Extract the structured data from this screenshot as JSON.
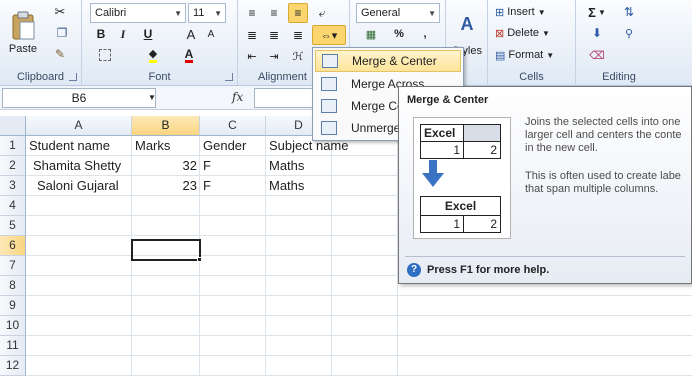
{
  "ribbon": {
    "clipboard": {
      "paste_label": "Paste",
      "group_label": "Clipboard"
    },
    "font": {
      "name": "Calibri",
      "size": "11",
      "bold": "B",
      "italic": "I",
      "underline": "U",
      "grow": "A",
      "shrink": "A",
      "font_color_letter": "A",
      "group_label": "Font"
    },
    "alignment": {
      "group_label": "Alignment"
    },
    "number": {
      "format": "General",
      "percent": "%",
      "comma": ","
    },
    "styles": {
      "label": "Styles"
    },
    "cells": {
      "insert": "Insert",
      "delete": "Delete",
      "format": "Format",
      "group_label": "Cells"
    },
    "editing": {
      "sigma": "Σ",
      "group_label": "Editing"
    }
  },
  "formula_bar": {
    "name_box": "B6",
    "fx_label": "fx"
  },
  "grid": {
    "columns": [
      "A",
      "B",
      "C",
      "D"
    ],
    "rows": [
      "1",
      "2",
      "3",
      "4",
      "5",
      "6",
      "7",
      "8",
      "9",
      "10",
      "11",
      "12"
    ],
    "cells": {
      "a1": "Student name",
      "b1": "Marks",
      "c1": "Gender",
      "d1": "Subject name",
      "a2": "Shamita Shetty",
      "b2": "32",
      "c2": "F",
      "d2": "Maths",
      "a3": "Saloni Gujaral",
      "b3": "23",
      "c3": "F",
      "d3": "Maths"
    }
  },
  "menu": {
    "items": [
      "Merge & Center",
      "Merge Across",
      "Merge Ce",
      "Unmerge"
    ]
  },
  "tooltip": {
    "title": "Merge & Center",
    "line1": "Joins the selected cells into one",
    "line2": "larger cell and centers the conte",
    "line3": "in the new cell.",
    "line4": "This is often used to create labe",
    "line5": "that span multiple columns.",
    "help": "Press F1 for more help.",
    "illus": {
      "top_label": "Excel",
      "v1": "1",
      "v2": "2",
      "bottom_label": "Excel",
      "v3": "1",
      "v4": "2"
    }
  }
}
